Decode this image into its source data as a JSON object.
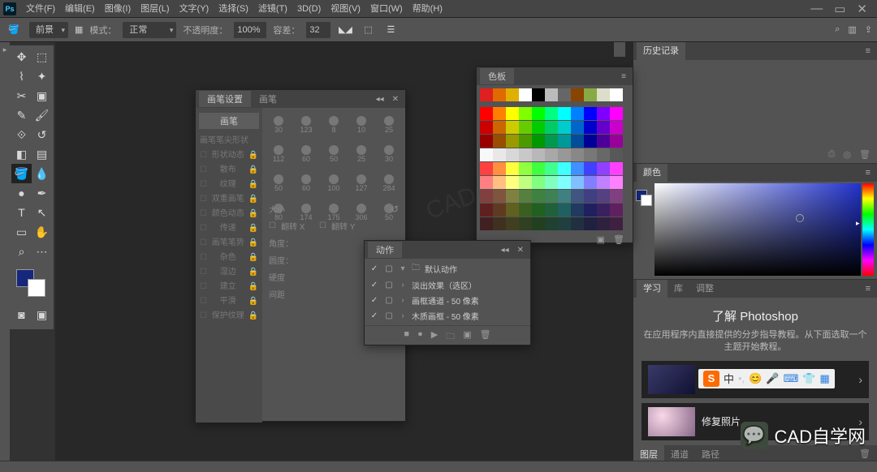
{
  "menubar": {
    "items": [
      "文件(F)",
      "编辑(E)",
      "图像(I)",
      "图层(L)",
      "文字(Y)",
      "选择(S)",
      "滤镜(T)",
      "3D(D)",
      "视图(V)",
      "窗口(W)",
      "帮助(H)"
    ]
  },
  "optbar": {
    "fill_mode": "前景",
    "mode_label": "模式：",
    "mode_value": "正常",
    "opacity_label": "不透明度：",
    "opacity_value": "100%",
    "tolerance_label": "容差：",
    "tolerance_value": "32"
  },
  "history_panel": {
    "title": "历史记录"
  },
  "color_panel": {
    "title": "颜色"
  },
  "learn_panel": {
    "tabs": [
      "学习",
      "库",
      "调整"
    ],
    "heading": "了解 Photoshop",
    "desc": "在应用程序内直接提供的分步指导教程。从下面选取一个主题开始教程。",
    "ime_cn": "中",
    "lesson2": "修复照片",
    "bottom_tabs": [
      "图层",
      "通道",
      "路径"
    ]
  },
  "brush_panel": {
    "tab1": "画笔设置",
    "tab2": "画笔",
    "side_btn": "画笔",
    "side_rows": [
      "画笔笔尖形状",
      "形状动态",
      "散布",
      "纹理",
      "双重画笔",
      "颜色动态",
      "传递",
      "画笔笔势",
      "杂色",
      "湿边",
      "建立",
      "平滑",
      "保护纹理"
    ],
    "preset_sizes": [
      "30",
      "123",
      "8",
      "10",
      "25",
      "112",
      "60",
      "50",
      "25",
      "30",
      "50",
      "60",
      "100",
      "127",
      "284",
      "80",
      "174",
      "175",
      "306",
      "50"
    ],
    "ctrl_size": "大小",
    "ctrl_flipx": "翻转 X",
    "ctrl_flipy": "翻转 Y",
    "ctrl_angle": "角度：",
    "ctrl_round": "圆度：",
    "ctrl_hard": "硬度",
    "ctrl_spacing": "间距"
  },
  "swatches_panel": {
    "title": "色板",
    "colors_row1": [
      "#e02020",
      "#e06a00",
      "#e0b000",
      "#ffffff",
      "#000000",
      "#bbbbbb",
      "#666666",
      "#884400",
      "#88aa44",
      "#ddddcc",
      "#ffffff"
    ],
    "grid": [
      [
        "#ff0000",
        "#ff8000",
        "#ffff00",
        "#80ff00",
        "#00ff00",
        "#00ff80",
        "#00ffff",
        "#0080ff",
        "#0000ff",
        "#8000ff",
        "#ff00ff"
      ],
      [
        "#cc0000",
        "#cc6600",
        "#cccc00",
        "#66cc00",
        "#00cc00",
        "#00cc66",
        "#00cccc",
        "#0066cc",
        "#0000cc",
        "#6600cc",
        "#cc00cc"
      ],
      [
        "#990000",
        "#994d00",
        "#999900",
        "#4d9900",
        "#009900",
        "#00994d",
        "#009999",
        "#004d99",
        "#000099",
        "#4d0099",
        "#990099"
      ],
      [
        "#f8f8f8",
        "#e8e8e8",
        "#d8d8d8",
        "#c8c8c8",
        "#b8b8b8",
        "#a8a8a8",
        "#989898",
        "#888888",
        "#787878",
        "#686868",
        "#585858"
      ],
      [
        "#ff4040",
        "#ff9040",
        "#ffff40",
        "#90ff40",
        "#40ff40",
        "#40ff90",
        "#40ffff",
        "#4090ff",
        "#4040ff",
        "#9040ff",
        "#ff40ff"
      ],
      [
        "#ff8080",
        "#ffc080",
        "#ffff80",
        "#c0ff80",
        "#80ff80",
        "#80ffc0",
        "#80ffff",
        "#80c0ff",
        "#8080ff",
        "#c080ff",
        "#ff80ff"
      ],
      [
        "#804040",
        "#805540",
        "#808040",
        "#558040",
        "#408040",
        "#408055",
        "#408080",
        "#405580",
        "#404080",
        "#554080",
        "#804080"
      ],
      [
        "#602020",
        "#603a20",
        "#606020",
        "#3a6020",
        "#206020",
        "#20603a",
        "#206060",
        "#203a60",
        "#202060",
        "#3a2060",
        "#602060"
      ],
      [
        "#402020",
        "#403020",
        "#404020",
        "#304020",
        "#204020",
        "#204030",
        "#204040",
        "#203040",
        "#202040",
        "#302040",
        "#402040"
      ]
    ]
  },
  "actions_panel": {
    "title": "动作",
    "rows": [
      {
        "name": "默认动作",
        "folder": true,
        "caret": "▾"
      },
      {
        "name": "淡出效果（选区）",
        "caret": "›"
      },
      {
        "name": "画框通道 - 50 像素",
        "caret": "›"
      },
      {
        "name": "木质画框 - 50 像素",
        "caret": "›"
      }
    ]
  },
  "branding": "CAD自学网"
}
